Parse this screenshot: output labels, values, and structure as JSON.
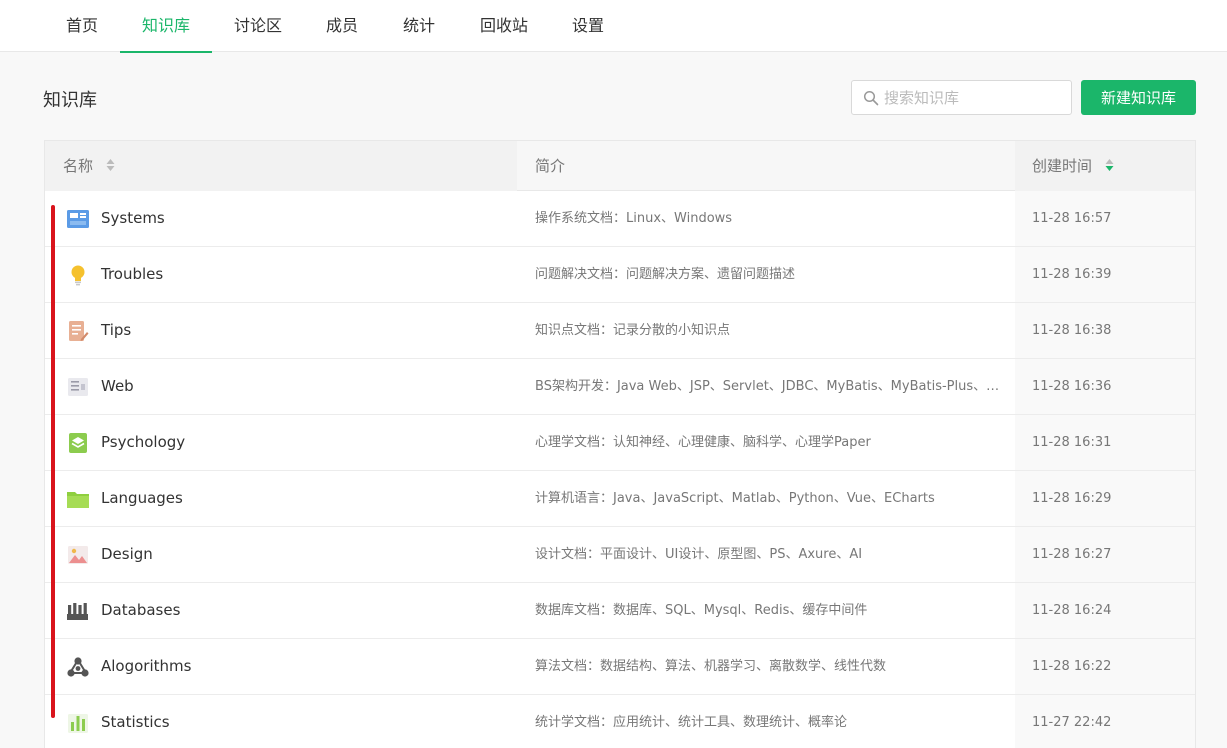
{
  "nav": {
    "tabs": [
      {
        "label": "首页"
      },
      {
        "label": "知识库"
      },
      {
        "label": "讨论区"
      },
      {
        "label": "成员"
      },
      {
        "label": "统计"
      },
      {
        "label": "回收站"
      },
      {
        "label": "设置"
      }
    ],
    "active_index": 1
  },
  "page": {
    "title": "知识库"
  },
  "search": {
    "placeholder": "搜索知识库",
    "value": ""
  },
  "new_button": {
    "label": "新建知识库"
  },
  "colors": {
    "accent": "#1bb66a",
    "annotation": "#d9141c"
  },
  "table": {
    "headers": {
      "name": "名称",
      "desc": "简介",
      "time": "创建时间"
    },
    "rows": [
      {
        "icon": "blog-board-icon",
        "name": "Systems",
        "desc": "操作系统文档：Linux、Windows",
        "time": "11-28 16:57"
      },
      {
        "icon": "lightbulb-icon",
        "name": "Troubles",
        "desc": "问题解决文档：问题解决方案、遗留问题描述",
        "time": "11-28 16:39"
      },
      {
        "icon": "notepad-pen-icon",
        "name": "Tips",
        "desc": "知识点文档：记录分散的小知识点",
        "time": "11-28 16:38"
      },
      {
        "icon": "document-list-icon",
        "name": "Web",
        "desc": "BS架构开发：Java Web、JSP、Servlet、JDBC、MyBatis、MyBatis-Plus、Sp...",
        "time": "11-28 16:36"
      },
      {
        "icon": "book-layers-icon",
        "name": "Psychology",
        "desc": "心理学文档：认知神经、心理健康、脑科学、心理学Paper",
        "time": "11-28 16:31"
      },
      {
        "icon": "folder-icon",
        "name": "Languages",
        "desc": "计算机语言：Java、JavaScript、Matlab、Python、Vue、ECharts",
        "time": "11-28 16:29"
      },
      {
        "icon": "picture-icon",
        "name": "Design",
        "desc": "设计文档：平面设计、UI设计、原型图、PS、Axure、AI",
        "time": "11-28 16:27"
      },
      {
        "icon": "database-bars-icon",
        "name": "Databases",
        "desc": "数据库文档：数据库、SQL、Mysql、Redis、缓存中间件",
        "time": "11-28 16:24"
      },
      {
        "icon": "network-nodes-icon",
        "name": "Alogorithms",
        "desc": "算法文档：数据结构、算法、机器学习、离散数学、线性代数",
        "time": "11-28 16:22"
      },
      {
        "icon": "bar-chart-icon",
        "name": "Statistics",
        "desc": "统计学文档：应用统计、统计工具、数理统计、概率论",
        "time": "11-27 22:42"
      }
    ]
  }
}
